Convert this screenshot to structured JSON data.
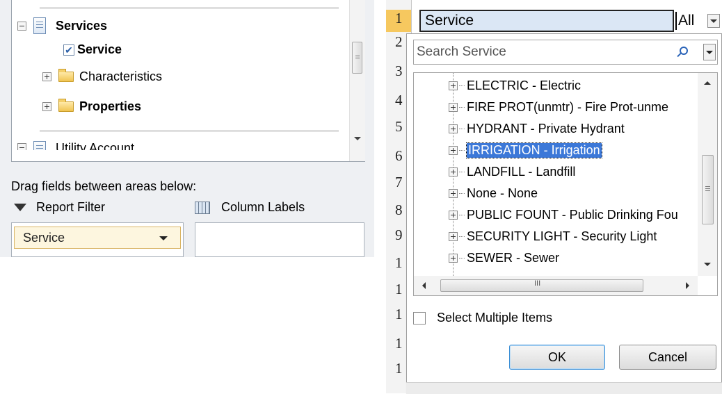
{
  "field_list": {
    "tree": {
      "services": "Services",
      "service": "Service",
      "characteristics": "Characteristics",
      "properties": "Properties",
      "utility_account": "Utility Account"
    },
    "drag_hint": "Drag fields between areas below:",
    "areas": {
      "report_filter": "Report Filter",
      "column_labels": "Column Labels"
    },
    "filter_chip": "Service"
  },
  "sheet": {
    "row_numbers": [
      "1",
      "2",
      "3",
      "4",
      "5",
      "6",
      "7",
      "8",
      "9",
      "1",
      "1",
      "1",
      "1",
      "1"
    ],
    "cell_a1": "Service",
    "cell_b1": "All"
  },
  "filter_popup": {
    "search_placeholder": "Search Service",
    "items": [
      "ELECTRIC - Electric",
      "FIRE PROT(unmtr) - Fire Prot-unme",
      "HYDRANT - Private Hydrant",
      "IRRIGATION - Irrigation",
      "LANDFILL - Landfill",
      "None - None",
      "PUBLIC FOUNT - Public Drinking Fou",
      "SECURITY LIGHT - Security Light",
      "SEWER - Sewer"
    ],
    "selected_item": "IRRIGATION - Irrigation",
    "hscroll_grip": "III",
    "select_multiple_label": "Select Multiple Items",
    "ok_label": "OK",
    "cancel_label": "Cancel"
  }
}
